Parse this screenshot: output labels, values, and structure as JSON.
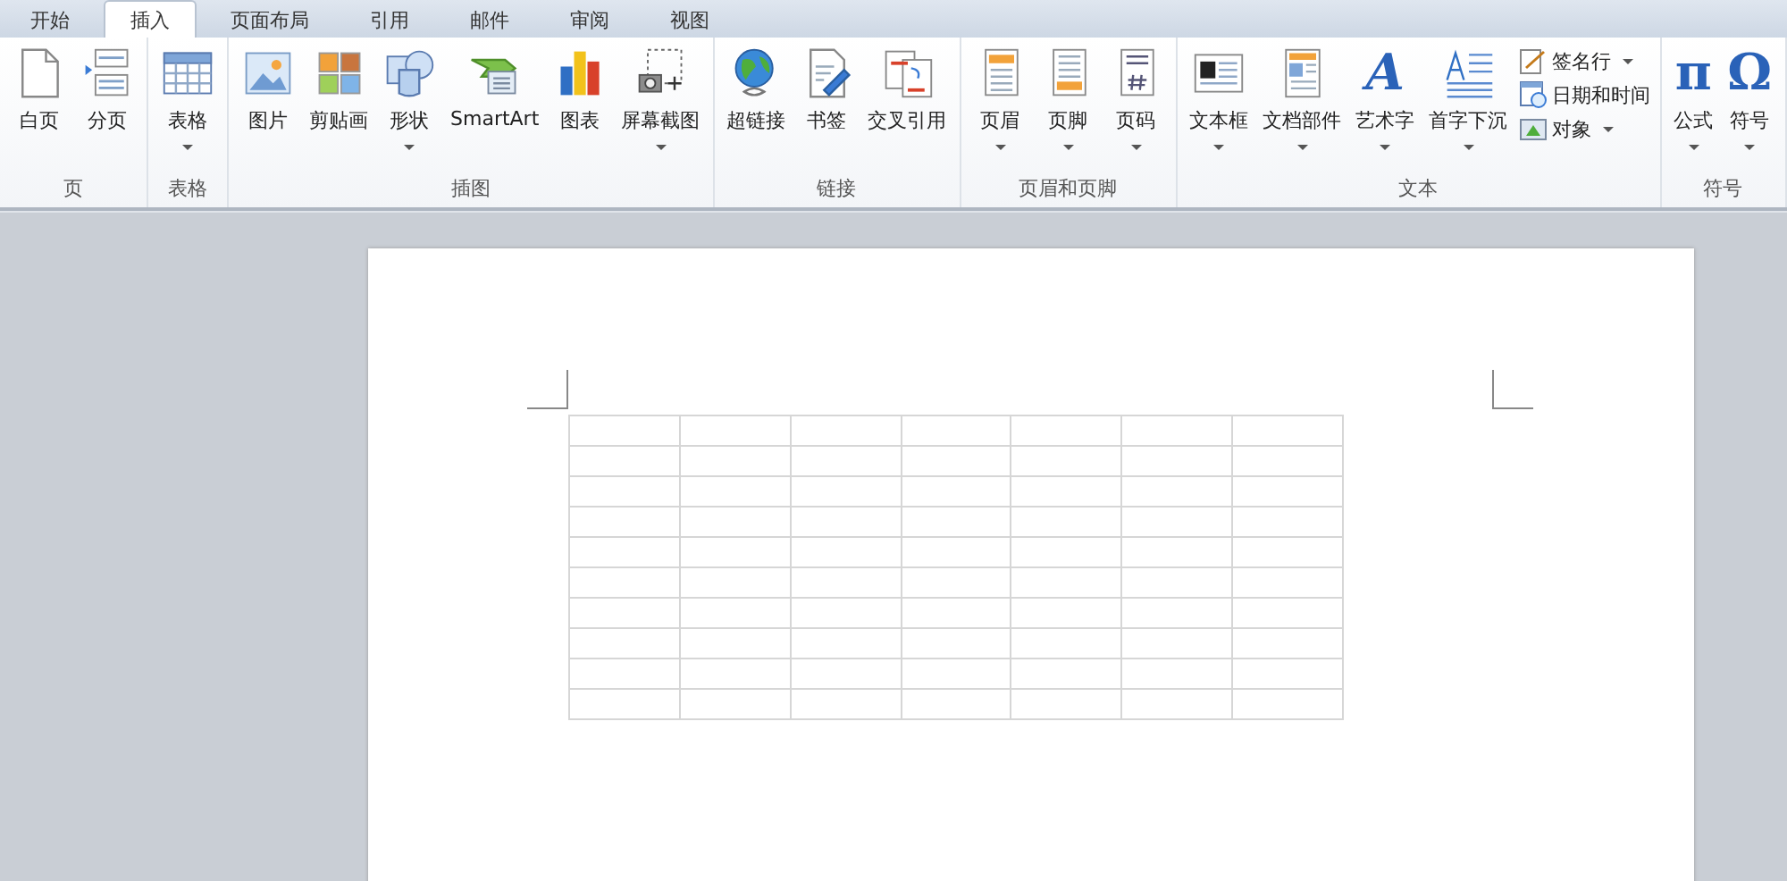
{
  "tabs": [
    {
      "label": "开始",
      "selected": false
    },
    {
      "label": "插入",
      "selected": true
    },
    {
      "label": "页面布局",
      "selected": false
    },
    {
      "label": "引用",
      "selected": false
    },
    {
      "label": "邮件",
      "selected": false
    },
    {
      "label": "审阅",
      "selected": false
    },
    {
      "label": "视图",
      "selected": false
    }
  ],
  "ribbon": {
    "groups": [
      {
        "label": "页",
        "buttons": [
          {
            "label": "白页",
            "dropdown": false
          },
          {
            "label": "分页",
            "dropdown": false
          }
        ]
      },
      {
        "label": "表格",
        "buttons": [
          {
            "label": "表格",
            "dropdown": true
          }
        ]
      },
      {
        "label": "插图",
        "buttons": [
          {
            "label": "图片",
            "dropdown": false
          },
          {
            "label": "剪贴画",
            "dropdown": false
          },
          {
            "label": "形状",
            "dropdown": true
          },
          {
            "label": "SmartArt",
            "dropdown": false
          },
          {
            "label": "图表",
            "dropdown": false
          },
          {
            "label": "屏幕截图",
            "dropdown": true
          }
        ]
      },
      {
        "label": "链接",
        "buttons": [
          {
            "label": "超链接",
            "dropdown": false
          },
          {
            "label": "书签",
            "dropdown": false
          },
          {
            "label": "交叉引用",
            "dropdown": false
          }
        ]
      },
      {
        "label": "页眉和页脚",
        "buttons": [
          {
            "label": "页眉",
            "dropdown": true
          },
          {
            "label": "页脚",
            "dropdown": true
          },
          {
            "label": "页码",
            "dropdown": true
          }
        ]
      },
      {
        "label": "文本",
        "buttons": [
          {
            "label": "文本框",
            "dropdown": true
          },
          {
            "label": "文档部件",
            "dropdown": true
          },
          {
            "label": "艺术字",
            "dropdown": true,
            "glyph": "A"
          },
          {
            "label": "首字下沉",
            "dropdown": true
          }
        ],
        "small_items": [
          {
            "label": "签名行",
            "dropdown": true
          },
          {
            "label": "日期和时间",
            "dropdown": false
          },
          {
            "label": "对象",
            "dropdown": true
          }
        ]
      },
      {
        "label": "符号",
        "buttons": [
          {
            "label": "公式",
            "dropdown": true,
            "glyph": "π"
          },
          {
            "label": "符号",
            "dropdown": true,
            "glyph": "Ω"
          }
        ]
      }
    ]
  }
}
